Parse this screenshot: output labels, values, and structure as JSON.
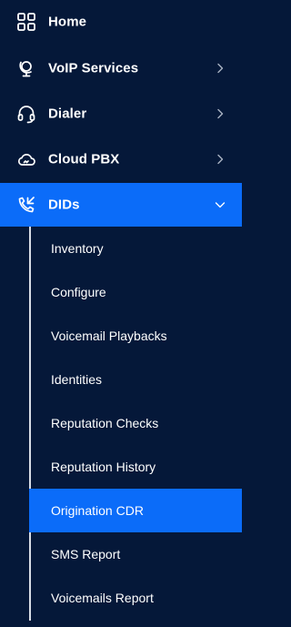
{
  "nav": {
    "items": [
      {
        "label": "Home",
        "icon": "grid-icon",
        "has_chevron": false
      },
      {
        "label": "VoIP Services",
        "icon": "globe-stand-icon",
        "has_chevron": true
      },
      {
        "label": "Dialer",
        "icon": "headset-icon",
        "has_chevron": true
      },
      {
        "label": "Cloud PBX",
        "icon": "cloud-icon",
        "has_chevron": true
      },
      {
        "label": "DIDs",
        "icon": "phone-incoming-icon",
        "has_chevron": true,
        "expanded": true,
        "active": true
      }
    ],
    "dids_submenu": [
      {
        "label": "Inventory"
      },
      {
        "label": "Configure"
      },
      {
        "label": "Voicemail Playbacks"
      },
      {
        "label": "Identities"
      },
      {
        "label": "Reputation Checks"
      },
      {
        "label": "Reputation History"
      },
      {
        "label": "Origination CDR",
        "active": true
      },
      {
        "label": "SMS Report"
      },
      {
        "label": "Voicemails Report"
      }
    ]
  },
  "colors": {
    "background": "#051839",
    "active": "#0b6cf9",
    "text": "#ffffff",
    "guide_line": "#d8dde6"
  }
}
